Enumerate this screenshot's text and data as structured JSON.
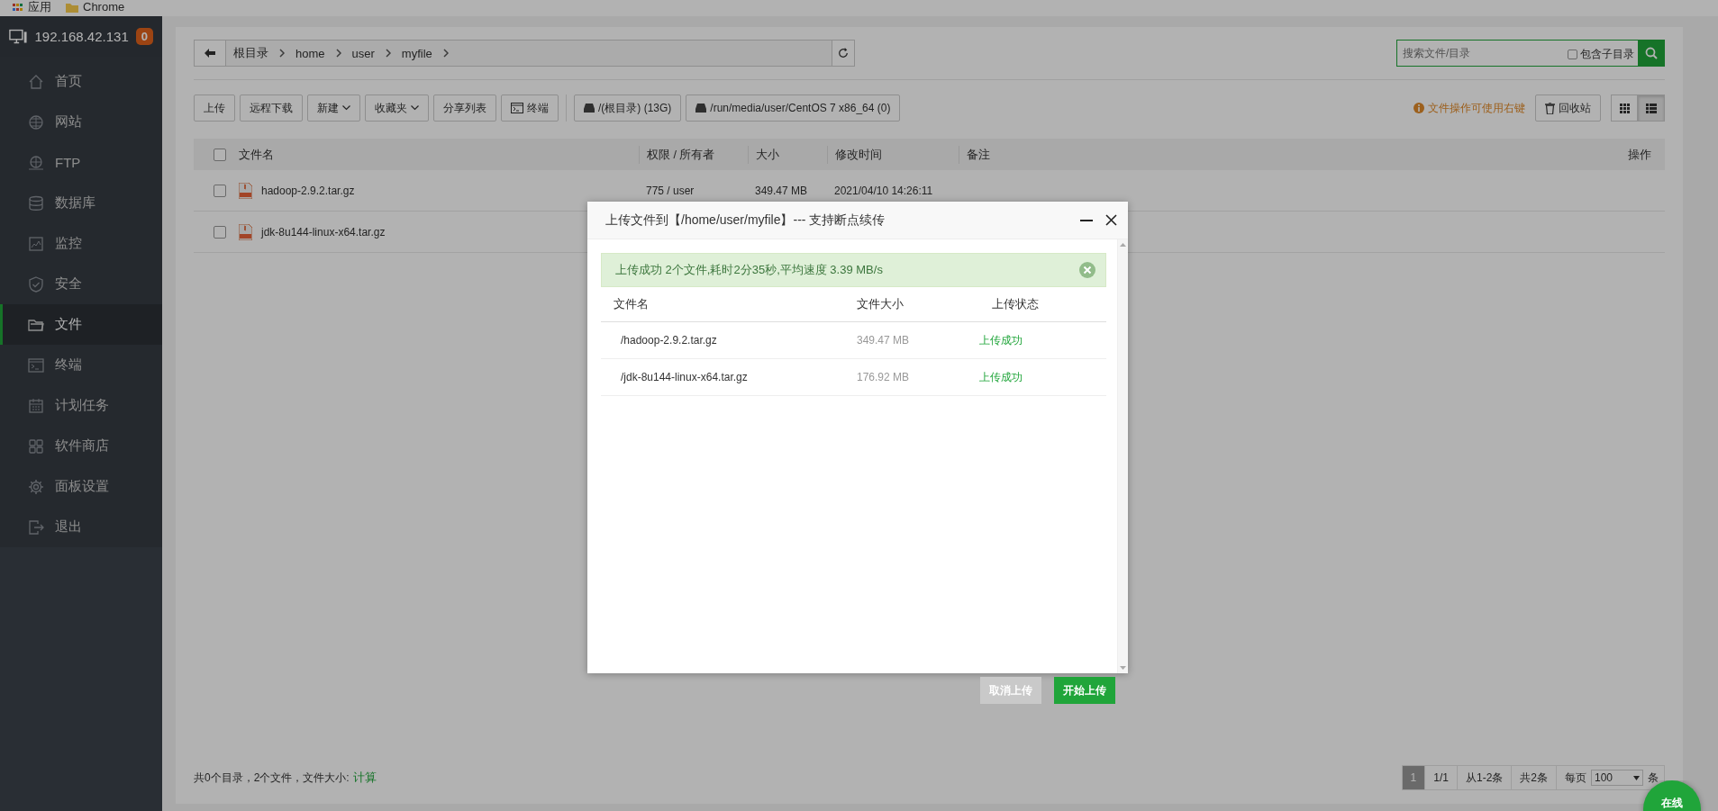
{
  "browser_bar": {
    "bookmarks": [
      "应用",
      "Chrome"
    ]
  },
  "sidebar": {
    "host": "192.168.42.131",
    "badge": "0",
    "items": [
      {
        "label": "首页",
        "selected": false
      },
      {
        "label": "网站",
        "selected": false
      },
      {
        "label": "FTP",
        "selected": false
      },
      {
        "label": "数据库",
        "selected": false
      },
      {
        "label": "监控",
        "selected": false
      },
      {
        "label": "安全",
        "selected": false
      },
      {
        "label": "文件",
        "selected": true
      },
      {
        "label": "终端",
        "selected": false
      },
      {
        "label": "计划任务",
        "selected": false
      },
      {
        "label": "软件商店",
        "selected": false
      },
      {
        "label": "面板设置",
        "selected": false
      },
      {
        "label": "退出",
        "selected": false
      }
    ]
  },
  "path_bar": {
    "crumbs": [
      "根目录",
      "home",
      "user",
      "myfile"
    ]
  },
  "search": {
    "placeholder": "搜索文件/目录",
    "include_subdirs": {
      "label": "包含子目录",
      "checked": false
    }
  },
  "toolbar": {
    "buttons": [
      {
        "label": "上传",
        "kind": "plain"
      },
      {
        "label": "远程下载",
        "kind": "plain"
      },
      {
        "label": "新建",
        "kind": "dropdown"
      },
      {
        "label": "收藏夹",
        "kind": "dropdown"
      },
      {
        "label": "分享列表",
        "kind": "plain"
      },
      {
        "label": "终端",
        "kind": "terminal"
      }
    ],
    "disks": [
      "/(根目录) (13G)",
      "/run/media/user/CentOS 7 x86_64 (0)"
    ],
    "hint": "文件操作可使用右键",
    "recycle": "回收站",
    "views": [
      {
        "kind": "grid",
        "selected": false
      },
      {
        "kind": "list",
        "selected": true
      }
    ]
  },
  "table": {
    "all_checked": false,
    "columns": [
      "文件名",
      "权限 / 所有者",
      "大小",
      "修改时间",
      "备注",
      "操作"
    ],
    "rows": [
      {
        "checked": false,
        "name": "hadoop-2.9.2.tar.gz",
        "perm": "775 / user",
        "size": "349.47 MB",
        "mtime": "2021/04/10 14:26:11"
      },
      {
        "checked": false,
        "name": "jdk-8u144-linux-x64.tar.gz"
      }
    ]
  },
  "footer": {
    "summary": "共0个目录，2个文件，文件大小:",
    "link": "计算",
    "pages": [
      {
        "label": "1",
        "selected": true
      }
    ],
    "info": [
      "1/1",
      "从1-2条",
      "共2条",
      "每页"
    ],
    "per_page": "100",
    "unit": "条"
  },
  "upload_dialog": {
    "title": "上传文件到【/home/user/myfile】--- 支持断点续传",
    "alert": "上传成功 2个文件,耗时2分35秒,平均速度 3.39 MB/s",
    "columns": [
      "文件名",
      "文件大小",
      "上传状态"
    ],
    "files": [
      {
        "name": "/hadoop-2.9.2.tar.gz",
        "size": "349.47 MB",
        "status": "上传成功"
      },
      {
        "name": "/jdk-8u144-linux-x64.tar.gz",
        "size": "176.92 MB",
        "status": "上传成功"
      }
    ],
    "buttons": [
      {
        "label": "取消上传",
        "kind": "cancel"
      },
      {
        "label": "开始上传",
        "kind": "primary"
      }
    ]
  },
  "online_badge": "在线"
}
